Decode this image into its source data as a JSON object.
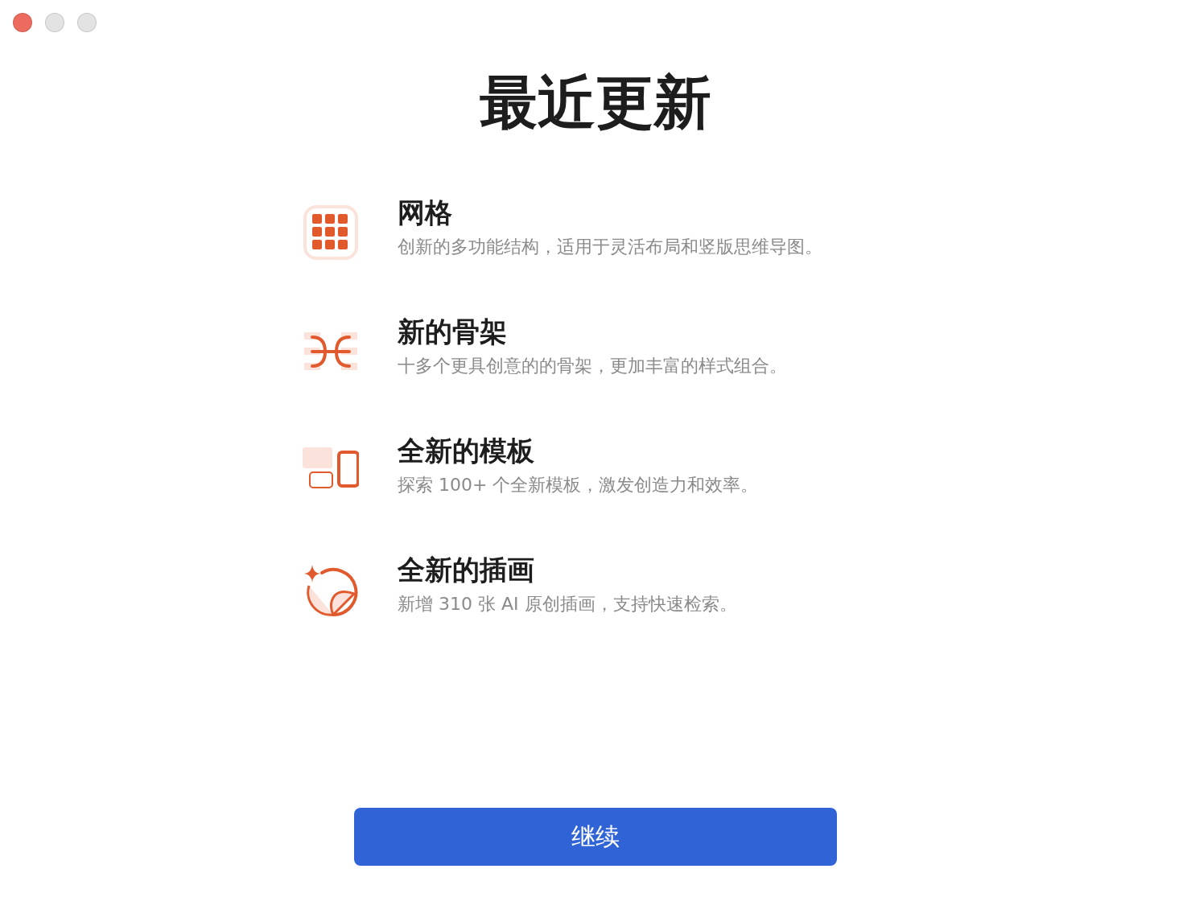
{
  "window": {
    "controls": [
      {
        "color": "#ec6a5e"
      },
      {
        "color": "#e3e3e3"
      },
      {
        "color": "#e3e3e3"
      }
    ]
  },
  "title": "最近更新",
  "features": [
    {
      "kind": "grid",
      "title": "网格",
      "description": "创新的多功能结构，适用于灵活布局和竖版思维导图。"
    },
    {
      "kind": "skeleton",
      "title": "新的骨架",
      "description": "十多个更具创意的的骨架，更加丰富的样式组合。"
    },
    {
      "kind": "templates",
      "title": "全新的模板",
      "description": "探索 100+ 个全新模板，激发创造力和效率。"
    },
    {
      "kind": "illustration",
      "title": "全新的插画",
      "description": "新增 310 张 AI 原创插画，支持快速检索。"
    }
  ],
  "button": "继续"
}
